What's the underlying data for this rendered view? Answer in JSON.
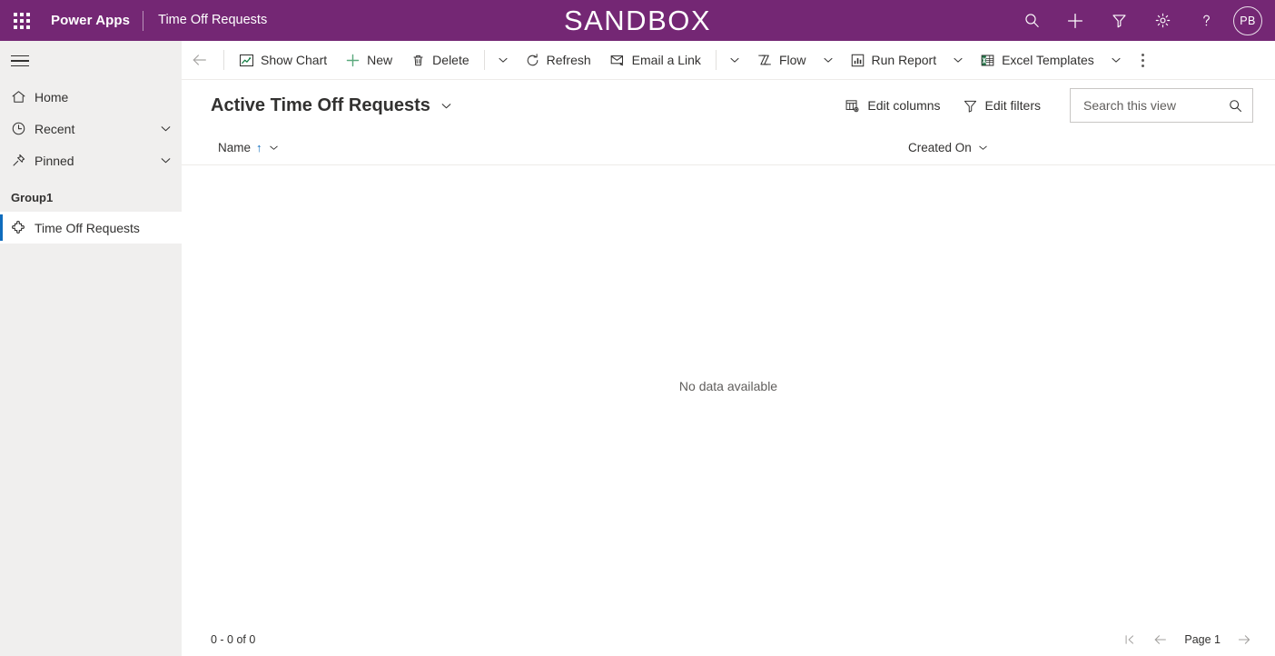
{
  "header": {
    "waffle_label": "app-launcher",
    "brand": "Power Apps",
    "app_name": "Time Off Requests",
    "environment": "SANDBOX",
    "purple": "#742774",
    "icons": [
      {
        "name": "search-icon",
        "title": "Search"
      },
      {
        "name": "plus-icon",
        "title": "Quick create"
      },
      {
        "name": "filter-icon",
        "title": "Filter"
      },
      {
        "name": "gear-icon",
        "title": "Settings"
      },
      {
        "name": "help-icon",
        "title": "Help"
      }
    ],
    "avatar_initials": "PB"
  },
  "sidebar": {
    "background": "#f0efee",
    "accent": "#0f6cbd",
    "hamburger_label": "Site Map",
    "items": [
      {
        "label": "Home",
        "icon": "home-icon",
        "chevron": false
      },
      {
        "label": "Recent",
        "icon": "clock-icon",
        "chevron": true
      },
      {
        "label": "Pinned",
        "icon": "pin-icon",
        "chevron": true
      }
    ],
    "group_title": "Group1",
    "group_items": [
      {
        "label": "Time Off Requests",
        "icon": "puzzle-icon",
        "selected": true
      }
    ]
  },
  "commandbar": {
    "back_label": "Back",
    "buttons": [
      {
        "label": "Show Chart",
        "icon": "chart-icon",
        "caret": false
      },
      {
        "label": "New",
        "icon": "plus-icon",
        "caret": false
      },
      {
        "label": "Delete",
        "icon": "trash-icon",
        "caret": true
      },
      {
        "label": "Refresh",
        "icon": "refresh-icon",
        "caret": false
      },
      {
        "label": "Email a Link",
        "icon": "email-icon",
        "caret": true
      },
      {
        "label": "Flow",
        "icon": "flow-icon",
        "caret": true
      },
      {
        "label": "Run Report",
        "icon": "report-icon",
        "caret": true
      },
      {
        "label": "Excel Templates",
        "icon": "excel-icon",
        "caret": true
      }
    ],
    "overflow_label": "More commands"
  },
  "view": {
    "title": "Active Time Off Requests",
    "edit_columns_label": "Edit columns",
    "edit_filters_label": "Edit filters",
    "search_placeholder": "Search this view",
    "search_value": ""
  },
  "grid": {
    "columns": [
      {
        "label": "Name",
        "sorted": "ascending",
        "sort_glyph": "↑"
      },
      {
        "label": "Created On",
        "sorted": "none",
        "sort_glyph": ""
      }
    ],
    "rows": [],
    "empty_message": "No data available"
  },
  "footer": {
    "record_count": "0 - 0 of 0",
    "first_page_label": "First page",
    "previous_page_label": "Previous page",
    "page_label": "Page 1",
    "next_page_label": "Next page"
  }
}
